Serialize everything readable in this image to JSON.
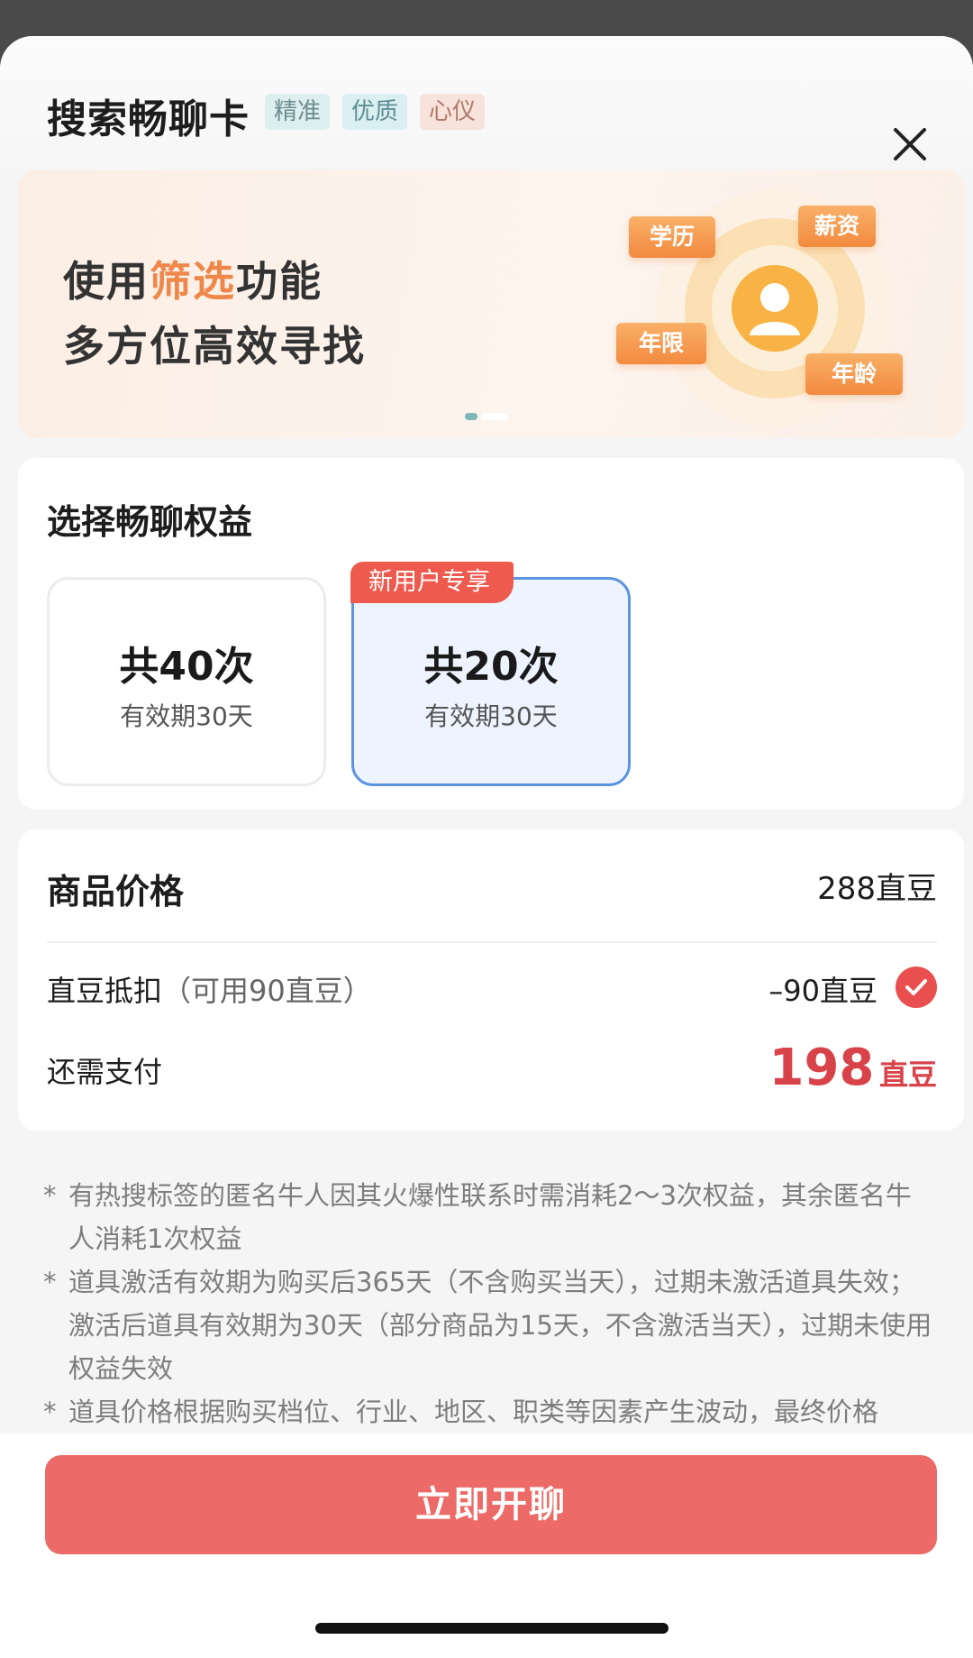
{
  "header": {
    "title": "搜索畅聊卡",
    "tags": [
      "精准",
      "优质",
      "心仪"
    ]
  },
  "banner": {
    "line1_prefix": "使用",
    "line1_highlight": "筛选",
    "line1_suffix": "功能",
    "line2": "多方位高效寻找",
    "chips": [
      "学历",
      "薪资",
      "年限",
      "年龄"
    ]
  },
  "rights": {
    "title": "选择畅聊权益",
    "options": [
      {
        "count": "共40次",
        "validity": "有效期30天",
        "badge": "",
        "selected": false
      },
      {
        "count": "共20次",
        "validity": "有效期30天",
        "badge": "新用户专享",
        "selected": true
      }
    ]
  },
  "price": {
    "label": "商品价格",
    "value": "288直豆",
    "deduct_label": "直豆抵扣",
    "deduct_note": "（可用90直豆）",
    "deduct_value": "–90直豆",
    "pay_label": "还需支付",
    "pay_value": "198",
    "pay_unit": "直豆"
  },
  "notes": [
    "有热搜标签的匿名牛人因其火爆性联系时需消耗2～3次权益，其余匿名牛人消耗1次权益",
    "道具激活有效期为购买后365天（不含购买当天），过期未激活道具失效；激活后道具有效期为30天（部分商品为15天，不含激活当天），过期未使用权益失效",
    "道具价格根据购买档位、行业、地区、职类等因素产生波动，最终价格"
  ],
  "cta": {
    "label": "立即开聊"
  },
  "colors": {
    "accent": "#ec6a67",
    "price_red": "#d8434a",
    "selected_border": "#5b95df",
    "badge_red": "#ef5a4f",
    "banner_highlight": "#f0874a"
  }
}
